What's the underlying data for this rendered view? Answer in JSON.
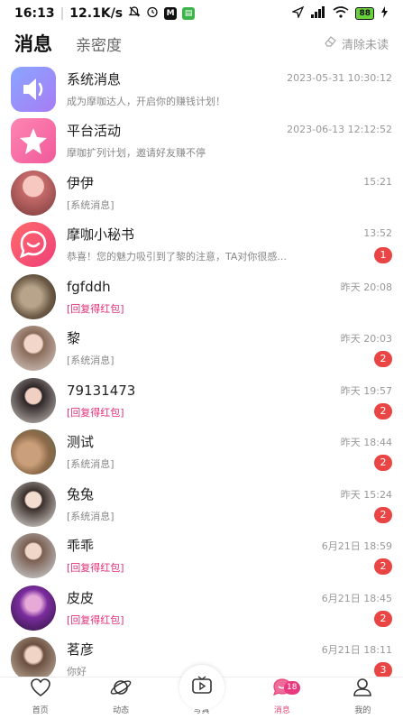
{
  "statusbar": {
    "time": "16:13",
    "speed": "12.1K/s",
    "battery": "88"
  },
  "header": {
    "tab_messages": "消息",
    "tab_intimacy": "亲密度",
    "clear_unread": "清除未读"
  },
  "conversations": [
    {
      "name": "系统消息",
      "preview": "成为摩咖达人，开启你的赚钱计划！",
      "time": "2023-05-31 10:30:12",
      "badge": "",
      "red": false,
      "avatar": "system-icon"
    },
    {
      "name": "平台活动",
      "preview": "摩咖扩列计划，邀请好友赚不停",
      "time": "2023-06-13 12:12:52",
      "badge": "",
      "red": false,
      "avatar": "star-icon"
    },
    {
      "name": "伊伊",
      "preview": "[系统消息]",
      "time": "15:21",
      "badge": "",
      "red": false,
      "avatar": "photo"
    },
    {
      "name": "摩咖小秘书",
      "preview": "恭喜！您的魅力吸引到了黎的注意，TA对你很感...",
      "time": "13:52",
      "badge": "1",
      "red": false,
      "avatar": "chat-icon"
    },
    {
      "name": "fgfddh",
      "preview": "[回复得红包]",
      "time": "昨天 20:08",
      "badge": "",
      "red": true,
      "avatar": "photo"
    },
    {
      "name": "黎",
      "preview": "[系统消息]",
      "time": "昨天 20:03",
      "badge": "2",
      "red": false,
      "avatar": "photo"
    },
    {
      "name": "79131473",
      "preview": "[回复得红包]",
      "time": "昨天 19:57",
      "badge": "2",
      "red": true,
      "avatar": "photo"
    },
    {
      "name": "测试",
      "preview": "[系统消息]",
      "time": "昨天 18:44",
      "badge": "2",
      "red": false,
      "avatar": "photo"
    },
    {
      "name": "兔兔",
      "preview": "[系统消息]",
      "time": "昨天 15:24",
      "badge": "2",
      "red": false,
      "avatar": "photo"
    },
    {
      "name": "乖乖",
      "preview": "[回复得红包]",
      "time": "6月21日 18:59",
      "badge": "2",
      "red": true,
      "avatar": "photo"
    },
    {
      "name": "皮皮",
      "preview": "[回复得红包]",
      "time": "6月21日 18:45",
      "badge": "2",
      "red": true,
      "avatar": "photo"
    },
    {
      "name": "茗彦",
      "preview": "你好",
      "time": "6月21日 18:11",
      "badge": "3",
      "red": false,
      "avatar": "photo"
    }
  ],
  "tabbar": {
    "home": "首页",
    "feed": "动态",
    "photo": "写真",
    "messages": "消息",
    "messages_badge": "18",
    "mine": "我的"
  }
}
